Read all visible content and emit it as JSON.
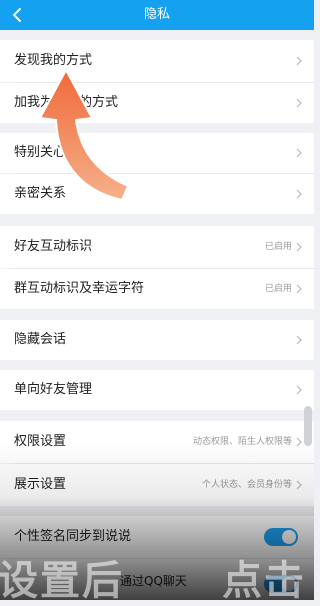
{
  "header": {
    "title": "隐私",
    "bg_color": "#14a2f0"
  },
  "rows": {
    "discover_me": {
      "label": "发现我的方式"
    },
    "add_friend": {
      "label": "加我为好友的方式"
    },
    "special": {
      "label": "特别关心"
    },
    "intimate": {
      "label": "亲密关系"
    },
    "friend_interaction": {
      "label": "好友互动标识",
      "value": "已启用"
    },
    "group_interaction": {
      "label": "群互动标识及幸运字符",
      "value": "已启用"
    },
    "hidden_chat": {
      "label": "隐藏会话"
    },
    "one_way_friends": {
      "label": "单向好友管理"
    },
    "permissions": {
      "label": "权限设置",
      "value": "动态权限、陌生人权限等"
    },
    "display": {
      "label": "展示设置",
      "value": "个人状态、会员身份等"
    },
    "signature_sync": {
      "label": "个性签名同步到说说"
    },
    "qq_chat": {
      "label": "通过QQ聊天"
    }
  },
  "overlay": {
    "left_text": "设置后",
    "right_text": "点击"
  },
  "colors": {
    "accent": "#1da1f2",
    "arrow": "#f07a4a"
  }
}
